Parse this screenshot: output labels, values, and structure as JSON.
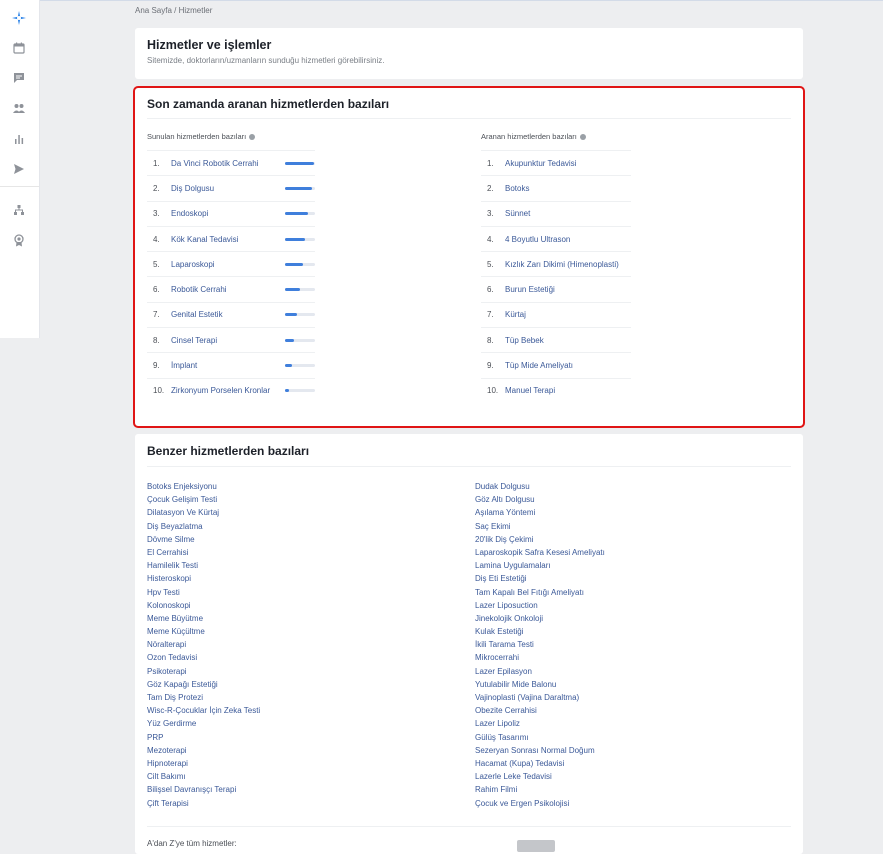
{
  "breadcrumb": "Ana Sayfa / Hizmetler",
  "header": {
    "title": "Hizmetler ve işlemler",
    "subtitle": "Sitemizde, doktorların/uzmanların sunduğu hizmetleri görebilirsiniz."
  },
  "sidebar": {
    "icons": [
      "star-logo-icon",
      "calendar-icon",
      "chat-icon",
      "users-icon",
      "bar-chart-icon",
      "send-icon",
      "hierarchy-icon",
      "award-icon"
    ]
  },
  "searched": {
    "title": "Son zamanda aranan hizmetlerden bazıları",
    "offered_heading": "Sunulan hizmetlerden bazıları",
    "searched_heading": "Aranan hizmetlerden bazıları",
    "offered": [
      {
        "num": "1.",
        "label": "Da Vinci Robotik Cerrahi",
        "level": 0.97
      },
      {
        "num": "2.",
        "label": "Diş Dolgusu",
        "level": 0.9
      },
      {
        "num": "3.",
        "label": "Endoskopi",
        "level": 0.78
      },
      {
        "num": "4.",
        "label": "Kök Kanal Tedavisi",
        "level": 0.68
      },
      {
        "num": "5.",
        "label": "Laparoskopi",
        "level": 0.6
      },
      {
        "num": "6.",
        "label": "Robotik Cerrahi",
        "level": 0.5
      },
      {
        "num": "7.",
        "label": "Genital Estetik",
        "level": 0.4
      },
      {
        "num": "8.",
        "label": "Cinsel Terapi",
        "level": 0.3
      },
      {
        "num": "9.",
        "label": "İmplant",
        "level": 0.22
      },
      {
        "num": "10.",
        "label": "Zirkonyum Porselen Kronlar",
        "level": 0.12
      }
    ],
    "searched_items": [
      {
        "num": "1.",
        "label": "Akupunktur Tedavisi"
      },
      {
        "num": "2.",
        "label": "Botoks"
      },
      {
        "num": "3.",
        "label": "Sünnet"
      },
      {
        "num": "4.",
        "label": "4 Boyutlu Ultrason"
      },
      {
        "num": "5.",
        "label": "Kızlık Zarı Dikimi (Himenoplasti)"
      },
      {
        "num": "6.",
        "label": "Burun Estetiği"
      },
      {
        "num": "7.",
        "label": "Kürtaj"
      },
      {
        "num": "8.",
        "label": "Tüp Bebek"
      },
      {
        "num": "9.",
        "label": "Tüp Mide Ameliyatı"
      },
      {
        "num": "10.",
        "label": "Manuel Terapi"
      }
    ]
  },
  "similar": {
    "title": "Benzer hizmetlerden bazıları",
    "left": [
      "Botoks Enjeksiyonu",
      "Çocuk Gelişim Testi",
      "Dilatasyon Ve Kürtaj",
      "Diş Beyazlatma",
      "Dövme Silme",
      "El Cerrahisi",
      "Hamilelik Testi",
      "Histeroskopi",
      "Hpv Testi",
      "Kolonoskopi",
      "Meme Büyütme",
      "Meme Küçültme",
      "Nöralterapi",
      "Ozon Tedavisi",
      "Psikoterapi",
      "Göz Kapağı Estetiği",
      "Tam Diş Protezi",
      "Wisc-R-Çocuklar İçin Zeka Testi",
      "Yüz Gerdirme",
      "PRP",
      "Mezoterapi",
      "Hipnoterapi",
      "Cilt Bakımı",
      "Bilişsel Davranışçı Terapi",
      "Çift Terapisi"
    ],
    "right": [
      "Dudak Dolgusu",
      "Göz Altı Dolgusu",
      "Aşılama Yöntemi",
      "Saç Ekimi",
      "20'lik Diş Çekimi",
      "Laparoskopik Safra Kesesi Ameliyatı",
      "Lamina Uygulamaları",
      "Diş Eti Estetiği",
      "Tam Kapalı Bel Fıtığı Ameliyatı",
      "Lazer Liposuction",
      "Jinekolojik Onkoloji",
      "Kulak Estetiği",
      "İkili Tarama Testi",
      "Mikrocerrahi",
      "Lazer Epilasyon",
      "Yutulabilir Mide Balonu",
      "Vajinoplasti (Vajina Daraltma)",
      "Obezite Cerrahisi",
      "Lazer Lipoliz",
      "Gülüş Tasarımı",
      "Sezeryan Sonrası Normal Doğum",
      "Hacamat (Kupa) Tedavisi",
      "Lazerle Leke Tedavisi",
      "Rahim Filmi",
      "Çocuk ve Ergen Psikolojisi"
    ],
    "az_label": "A'dan Z'ye tüm hizmetler:"
  },
  "colors": {
    "accent": "#3f7fdc",
    "link": "#3b5998",
    "highlight_border": "#e01515"
  }
}
